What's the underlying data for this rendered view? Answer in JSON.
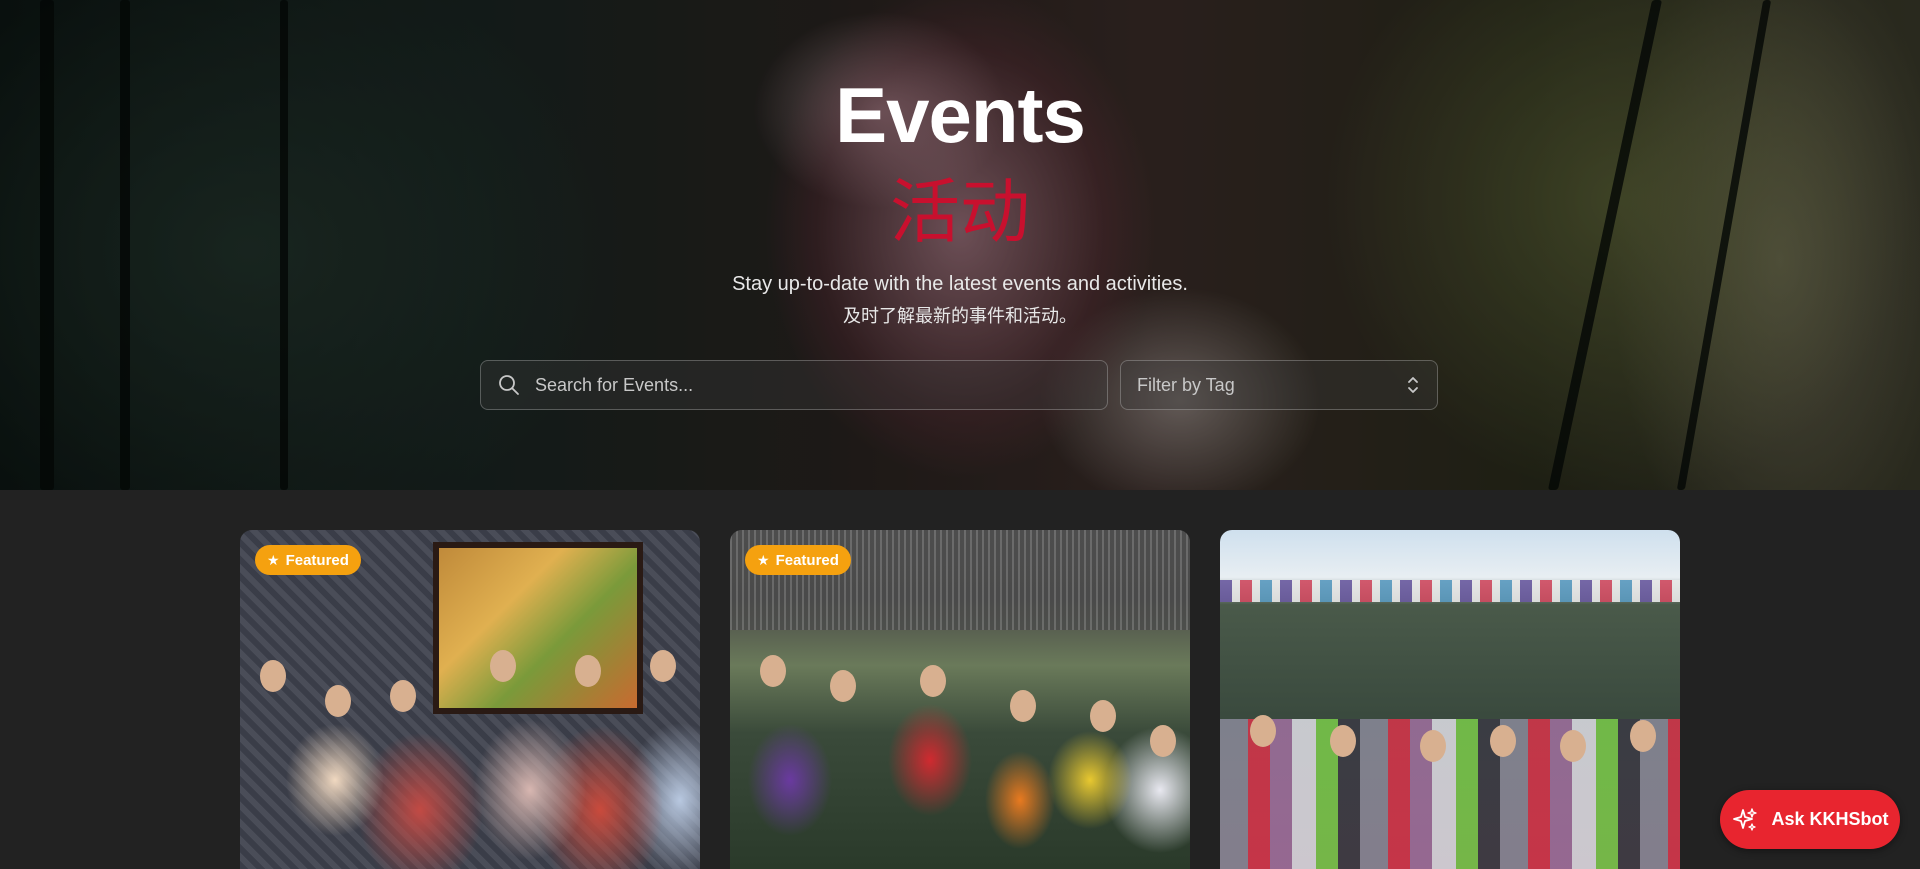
{
  "hero": {
    "title": "Events",
    "title_cn": "活动",
    "subtitle": "Stay up-to-date with the latest events and activities.",
    "subtitle_cn": "及时了解最新的事件和活动。"
  },
  "search": {
    "placeholder": "Search for Events...",
    "value": ""
  },
  "filter": {
    "label": "Filter by Tag"
  },
  "cards": [
    {
      "badge": "Featured",
      "featured": true
    },
    {
      "badge": "Featured",
      "featured": true
    },
    {
      "badge": "",
      "featured": false
    }
  ],
  "chat": {
    "label": "Ask KKHSbot"
  },
  "colors": {
    "accent_red": "#c8102e",
    "badge_orange": "#f5a10f",
    "chat_button": "#e8252f",
    "page_bg": "#222222"
  },
  "icons": {
    "search": "search-icon",
    "filter": "chevron-updown-icon",
    "badge": "star-icon",
    "chat": "sparkles-icon"
  }
}
